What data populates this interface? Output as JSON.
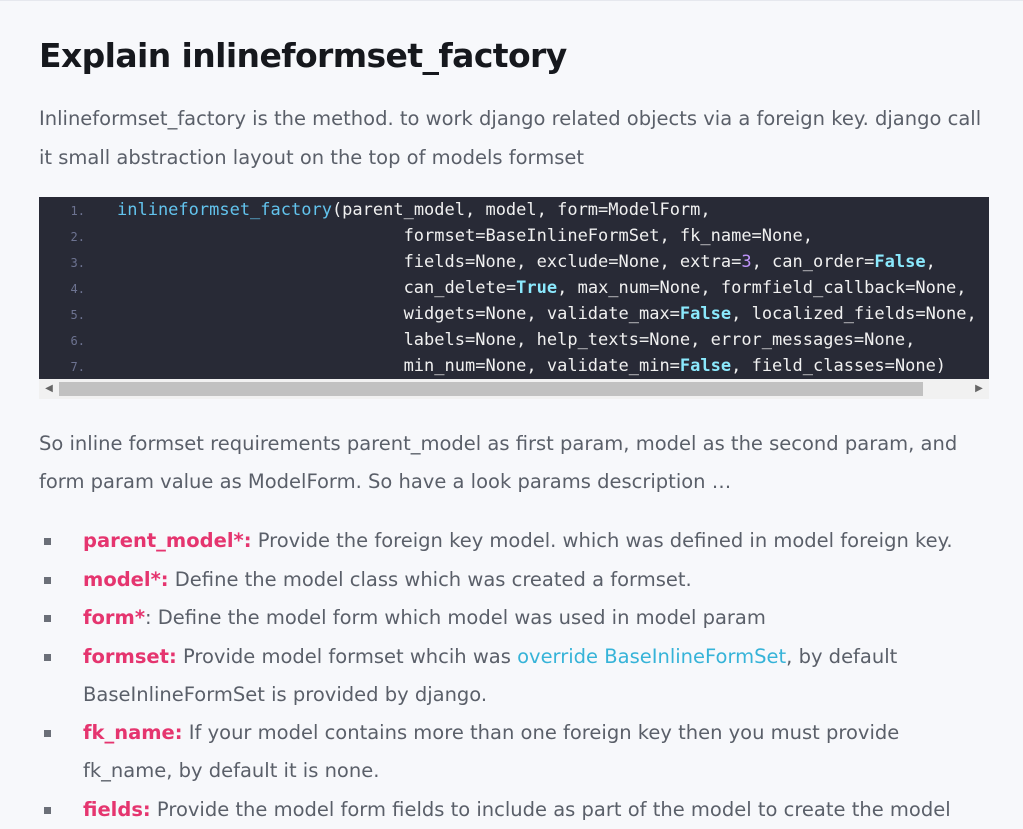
{
  "heading": "Explain inlineformset_factory",
  "intro": "Inlineformset_factory is the method. to work django related objects via a foreign key. django call it small abstraction layout on the top of models formset",
  "code": {
    "lines": [
      {
        "num": "1.",
        "fn": "inlineformset_factory",
        "parts": [
          "(parent_model, model, form=ModelForm,"
        ]
      },
      {
        "num": "2.",
        "text": "                            formset=BaseInlineFormSet, fk_name=None,"
      },
      {
        "num": "3.",
        "a": "                            fields=None, exclude=None, extra=",
        "n": "3",
        "b": ", can_order=",
        "k": "False",
        "c": ","
      },
      {
        "num": "4.",
        "a": "                            can_delete=",
        "k": "True",
        "b": ", max_num=None, formfield_callback=None,"
      },
      {
        "num": "5.",
        "a": "                            widgets=None, validate_max=",
        "k": "False",
        "b": ", localized_fields=None,"
      },
      {
        "num": "6.",
        "text": "                            labels=None, help_texts=None, error_messages=None,"
      },
      {
        "num": "7.",
        "a": "                            min_num=None, validate_min=",
        "k": "False",
        "b": ", field_classes=None)"
      }
    ]
  },
  "para2": "So inline formset requirements parent_model as first param, model as the second param, and form param value as ModelForm. So have a look params description …",
  "params": [
    {
      "name": "parent_model*:",
      "desc": " Provide the foreign key model. which was defined in model foreign key."
    },
    {
      "name": "model*:",
      "desc": " Define the model class which was created a formset."
    },
    {
      "name": "form*",
      "desc": ": Define the model form which model was used in model param"
    },
    {
      "name": "formset:",
      "desc_before": " Provide model formset whcih was ",
      "link": "override BaseInlineFormSet",
      "desc_after": ", by default BaseInlineFormSet is provided by django."
    },
    {
      "name": "fk_name:",
      "desc": " If your model contains more than one foreign key then you must provide fk_name, by default it is none."
    },
    {
      "name": "fields:",
      "desc": " Provide the model form fields to include as part of the model to create the model"
    }
  ],
  "colors": {
    "param_name": "#e5356f",
    "link": "#36b3d8",
    "code_bg": "#282a36",
    "code_keyword": "#8be9fd",
    "code_number": "#bd93f9"
  },
  "icons": {
    "scroll_left": "left-arrow-icon",
    "scroll_right": "right-arrow-icon"
  }
}
